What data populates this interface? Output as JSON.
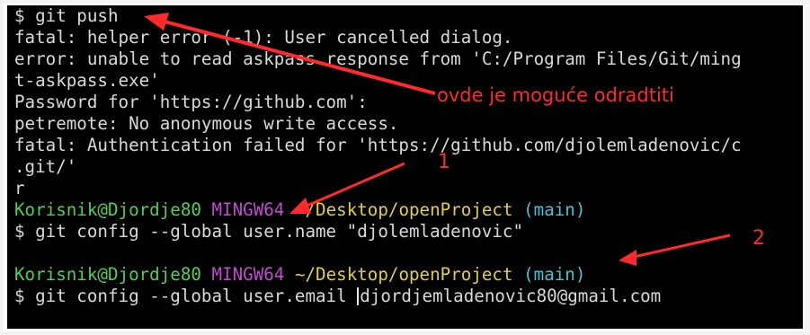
{
  "terminal": {
    "lines": [
      {
        "type": "cmd",
        "text": "$ git push"
      },
      {
        "type": "out",
        "text": "fatal: helper error (-1): User cancelled dialog."
      },
      {
        "type": "out",
        "text": "error: unable to read askpass response from 'C:/Program Files/Git/ming"
      },
      {
        "type": "out",
        "text": "t-askpass.exe'"
      },
      {
        "type": "out",
        "text": "Password for 'https://github.com':"
      },
      {
        "type": "out",
        "text": "petremote: No anonymous write access."
      },
      {
        "type": "out",
        "text": "fatal: Authentication failed for 'https://github.com/djolemladenovic/c"
      },
      {
        "type": "out",
        "text": ".git/'"
      },
      {
        "type": "out",
        "text": "r"
      },
      {
        "type": "prompt",
        "user": "Korisnik@Djordje80",
        "host": "MINGW64",
        "path": "~/Desktop/openProject",
        "branch": "(main)"
      },
      {
        "type": "cmd",
        "text": "$ git config --global user.name \"djolemladenovic\""
      },
      {
        "type": "blank",
        "text": ""
      },
      {
        "type": "prompt",
        "user": "Korisnik@Djordje80",
        "host": "MINGW64",
        "path": "~/Desktop/openProject",
        "branch": "(main)"
      },
      {
        "type": "cmd_cursor",
        "before": "$ git config --global user.email ",
        "after": "djordjemladenovic80@gmail.com"
      }
    ]
  },
  "annotations": {
    "note_text": "ovde je moguće odradtiti",
    "marker_1": "1",
    "marker_2": "2",
    "color": "#ff2a2a"
  }
}
